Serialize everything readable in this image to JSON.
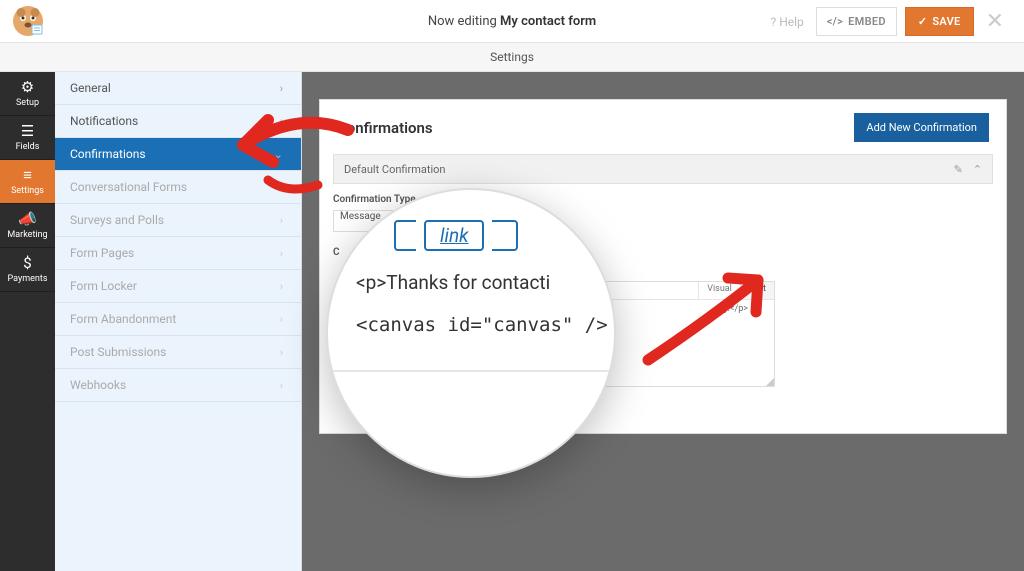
{
  "topbar": {
    "now_editing_prefix": "Now editing ",
    "form_name": "My contact form",
    "help_label": "Help",
    "embed_label": "EMBED",
    "save_label": "SAVE"
  },
  "secondbar": {
    "title": "Settings"
  },
  "leftnav": [
    {
      "icon": "⚙",
      "label": "Setup"
    },
    {
      "icon": "☰",
      "label": "Fields"
    },
    {
      "icon": "≡",
      "label": "Settings"
    },
    {
      "icon": "📣",
      "label": "Marketing"
    },
    {
      "icon": "$",
      "label": "Payments"
    }
  ],
  "sidebar": {
    "items": [
      {
        "label": "General",
        "chev": "›"
      },
      {
        "label": "Notifications",
        "chev": "›"
      },
      {
        "label": "Confirmations",
        "chev": "⌄"
      },
      {
        "label": "Conversational Forms",
        "chev": "›"
      },
      {
        "label": "Surveys and Polls",
        "chev": "›"
      },
      {
        "label": "Form Pages",
        "chev": "›"
      },
      {
        "label": "Form Locker",
        "chev": "›"
      },
      {
        "label": "Form Abandonment",
        "chev": "›"
      },
      {
        "label": "Post Submissions",
        "chev": "›"
      },
      {
        "label": "Webhooks",
        "chev": "›"
      }
    ]
  },
  "panel": {
    "title": "Confirmations",
    "add_button": "Add New Confirmation",
    "default_row": "Default Confirmation",
    "type_label": "Confirmation Type",
    "type_value": "Message",
    "cut_label": "C",
    "editor_tab_visual": "Visual",
    "editor_tab_text": "Text",
    "editor_content_tail": "ly.</p>"
  },
  "magnifier": {
    "link_btn": "link",
    "line1": "<p>Thanks for contacti",
    "line2": "<canvas id=\"canvas\" />"
  },
  "glyphs": {
    "help": "?",
    "check": "✓",
    "close": "✕",
    "embed_code": "</>",
    "pencil": "✎",
    "collapse": "⌃"
  }
}
